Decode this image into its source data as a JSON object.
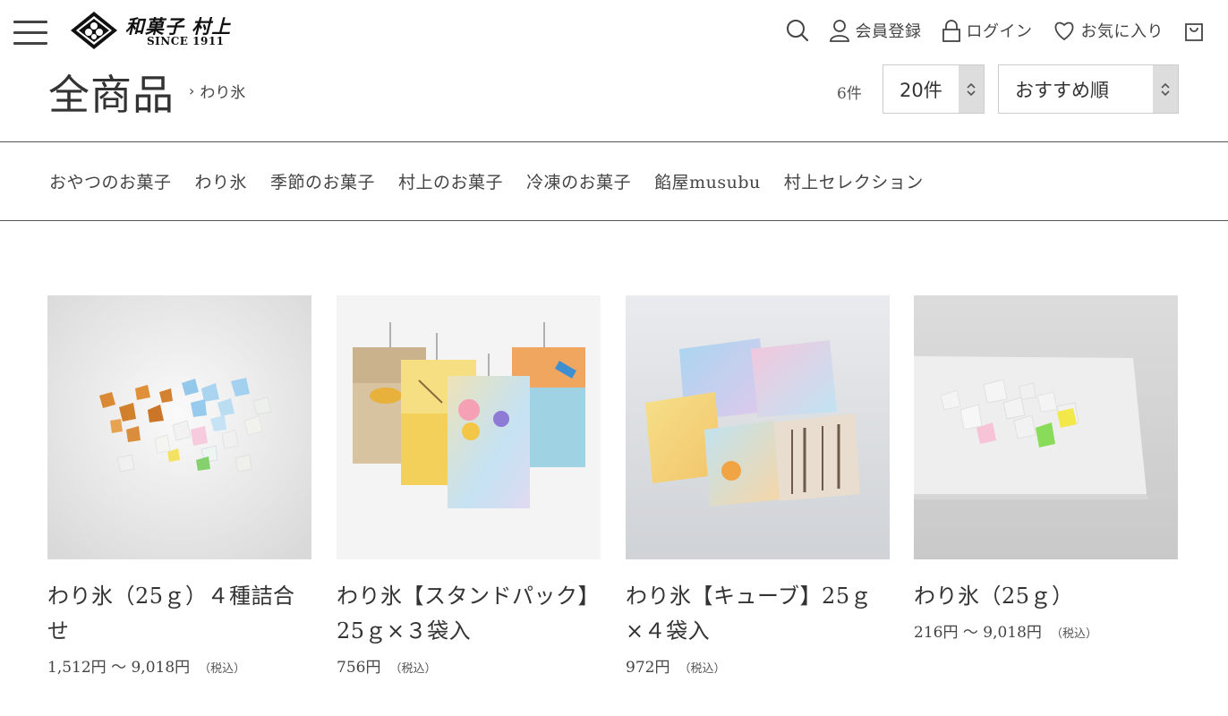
{
  "header": {
    "logo_name": "和菓子 村上",
    "logo_since": "SINCE 1911",
    "nav": {
      "search_icon": "search-icon",
      "register_label": "会員登録",
      "login_label": "ログイン",
      "favorites_label": "お気に入り",
      "cart_icon": "cart-icon"
    }
  },
  "title_bar": {
    "page_title": "全商品",
    "breadcrumb_sep": "›",
    "breadcrumb_current": "わり氷",
    "count": "6件",
    "per_page": "20件",
    "sort": "おすすめ順"
  },
  "categories": [
    "おやつのお菓子",
    "わり氷",
    "季節のお菓子",
    "村上のお菓子",
    "冷凍のお菓子",
    "餡屋musubu",
    "村上セレクション"
  ],
  "products": [
    {
      "name": "わり氷（25ｇ）４種詰合せ",
      "price": "1,512円 〜 9,018円",
      "tax": "（税込）"
    },
    {
      "name": "わり氷【スタンドパック】25ｇ×３袋入",
      "price": "756円",
      "tax": "（税込）"
    },
    {
      "name": "わり氷【キューブ】25ｇ×４袋入",
      "price": "972円",
      "tax": "（税込）"
    },
    {
      "name": "わり氷（25ｇ）",
      "price": "216円 〜 9,018円",
      "tax": "（税込）"
    }
  ]
}
